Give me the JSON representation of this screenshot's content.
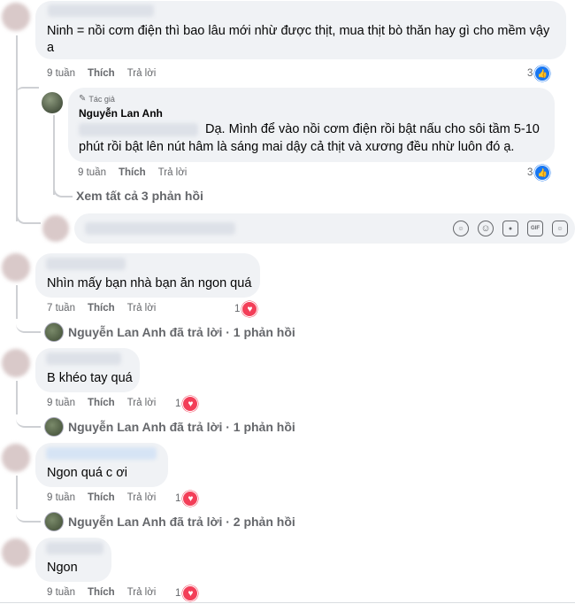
{
  "comments": [
    {
      "text": "Ninh = nồi cơm điện thì bao lâu mới nhừ được thịt, mua thịt bò thăn hay gì cho mềm vậy a",
      "time": "9 tuần",
      "like": "Thích",
      "reply": "Trả lời",
      "reaction_count": "3",
      "reaction_type": "like"
    },
    {
      "text": "Nhìn mấy bạn nhà bạn ăn ngon quá",
      "time": "7 tuần",
      "like": "Thích",
      "reply": "Trả lời",
      "reaction_count": "1",
      "reaction_type": "love",
      "replies_label": "Nguyễn Lan Anh đã trả lời · 1 phản hồi"
    },
    {
      "text": "B khéo tay quá",
      "time": "9 tuần",
      "like": "Thích",
      "reply": "Trả lời",
      "reaction_count": "1",
      "reaction_type": "love",
      "replies_label": "Nguyễn Lan Anh đã trả lời · 1 phản hồi"
    },
    {
      "text": "Ngon quá c ơi",
      "time": "9 tuần",
      "like": "Thích",
      "reply": "Trả lời",
      "reaction_count": "1",
      "reaction_type": "love",
      "replies_label": "Nguyễn Lan Anh đã trả lời · 2 phản hồi"
    },
    {
      "text": "Ngon",
      "time": "9 tuần",
      "like": "Thích",
      "reply": "Trả lời",
      "reaction_count": "1",
      "reaction_type": "love"
    }
  ],
  "author_reply": {
    "badge": "Tác giả",
    "name": "Nguyễn Lan Anh",
    "text_line1": "Dạ. Mình để vào nồi cơm điện rồi bật nấu cho sôi tầm 5-10",
    "text_line2": "phút rồi bật lên nút hâm là sáng mai dậy cả thịt và xương đều nhừ luôn đó ạ.",
    "time": "9 tuần",
    "like": "Thích",
    "reply": "Trả lời",
    "reaction_count": "3",
    "reaction_type": "like"
  },
  "view_all_replies": "Xem tất cả 3 phản hồi",
  "composer_icons": [
    "avatar-sticker-icon",
    "emoji-icon",
    "camera-icon",
    "gif-icon",
    "sticker-icon"
  ],
  "colors": {
    "love": "#f33e58",
    "like": "#1877f2",
    "bubble": "#f0f2f5",
    "meta": "#65676b"
  }
}
